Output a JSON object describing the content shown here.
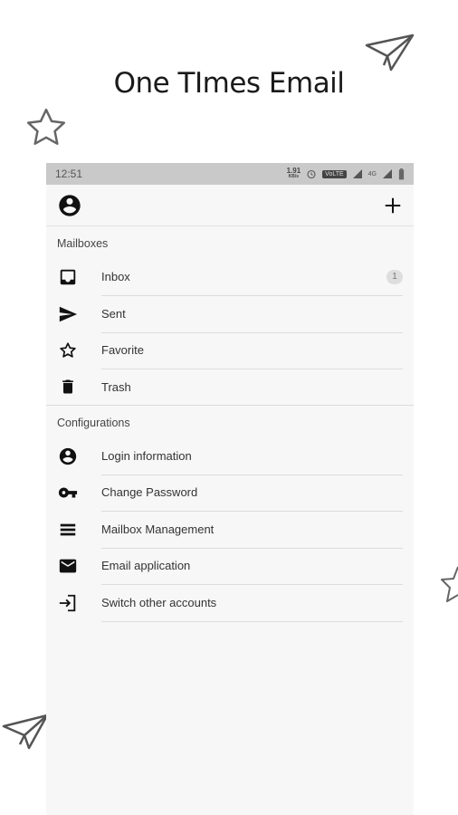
{
  "headline": "One TImes Email",
  "status_bar": {
    "time": "12:51",
    "net_speed_value": "1.91",
    "net_speed_unit": "KB/s",
    "lte_label": "VoLTE",
    "signal_label": "4G"
  },
  "mailboxes": {
    "title": "Mailboxes",
    "items": [
      {
        "label": "Inbox",
        "icon": "inbox-icon",
        "badge": "1"
      },
      {
        "label": "Sent",
        "icon": "send-icon"
      },
      {
        "label": "Favorite",
        "icon": "star-outline-icon"
      },
      {
        "label": "Trash",
        "icon": "trash-icon"
      }
    ]
  },
  "configurations": {
    "title": "Configurations",
    "items": [
      {
        "label": "Login information",
        "icon": "account-circle-icon"
      },
      {
        "label": "Change Password",
        "icon": "key-icon"
      },
      {
        "label": "Mailbox Management",
        "icon": "menu-icon"
      },
      {
        "label": "Email application",
        "icon": "mail-icon"
      },
      {
        "label": "Switch other accounts",
        "icon": "switch-account-icon"
      }
    ]
  },
  "colors": {
    "statusbar": "#c9c9c9",
    "panel": "#f7f7f7",
    "icon": "#111111"
  }
}
